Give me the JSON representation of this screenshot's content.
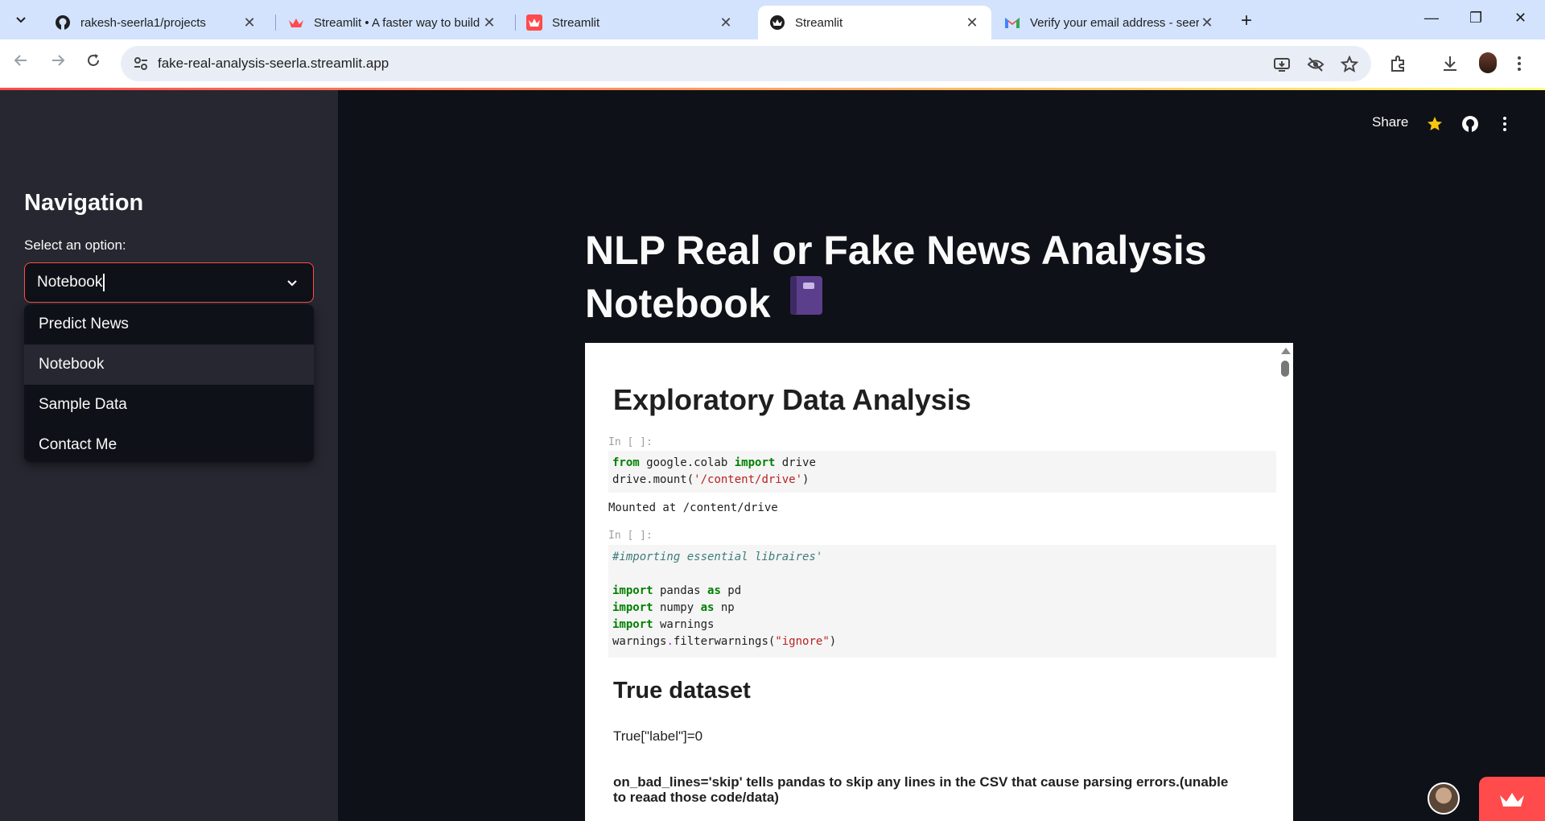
{
  "browser": {
    "tabs": [
      {
        "title": "rakesh-seerla1/projects",
        "icon": "github-icon"
      },
      {
        "title": "Streamlit • A faster way to build",
        "icon": "streamlit-icon"
      },
      {
        "title": "Streamlit",
        "icon": "streamlit-icon"
      },
      {
        "title": "Streamlit",
        "icon": "streamlit-icon",
        "active": true
      },
      {
        "title": "Verify your email address - seerla",
        "icon": "gmail-icon"
      }
    ],
    "url": "fake-real-analysis-seerla.streamlit.app"
  },
  "header": {
    "share_label": "Share"
  },
  "sidebar": {
    "title": "Navigation",
    "select_label": "Select an option:",
    "selected_value": "Notebook",
    "options": [
      "Predict News",
      "Notebook",
      "Sample Data",
      "Contact Me"
    ]
  },
  "main": {
    "title_line1": "NLP Real or Fake News Analysis",
    "title_line2": "Notebook"
  },
  "notebook": {
    "heading": "Exploratory Data Analysis",
    "prompt1": "In [ ]:",
    "code1": {
      "l1_kw1": "from",
      "l1_mod": " google.colab ",
      "l1_kw2": "import",
      "l1_name": " drive",
      "l2_pre": "drive.mount(",
      "l2_str": "'/content/drive'",
      "l2_post": ")"
    },
    "output1": "Mounted at /content/drive",
    "prompt2": "In [ ]:",
    "code2": {
      "comment": "#importing essential libraires'",
      "l1_kw": "import",
      "l1_rest1": " pandas ",
      "l1_as": "as",
      "l1_rest2": " pd",
      "l2_kw": "import",
      "l2_rest1": " numpy ",
      "l2_as": "as",
      "l2_rest2": " np",
      "l3_kw": "import",
      "l3_rest": " warnings",
      "l4_pre": "warnings",
      "l4_dot": ".",
      "l4_fn": "filterwarnings(",
      "l4_str": "\"ignore\"",
      "l4_post": ")"
    },
    "section": "True dataset",
    "label_line": "True[\"label\"]=0",
    "bold_note": "on_bad_lines='skip' tells pandas to skip any lines in the CSV that cause parsing errors.(unable to reaad those code/data)"
  },
  "colors": {
    "accent": "#ff4b4b",
    "sidebar_bg": "#262730",
    "app_bg": "#0e1117"
  }
}
